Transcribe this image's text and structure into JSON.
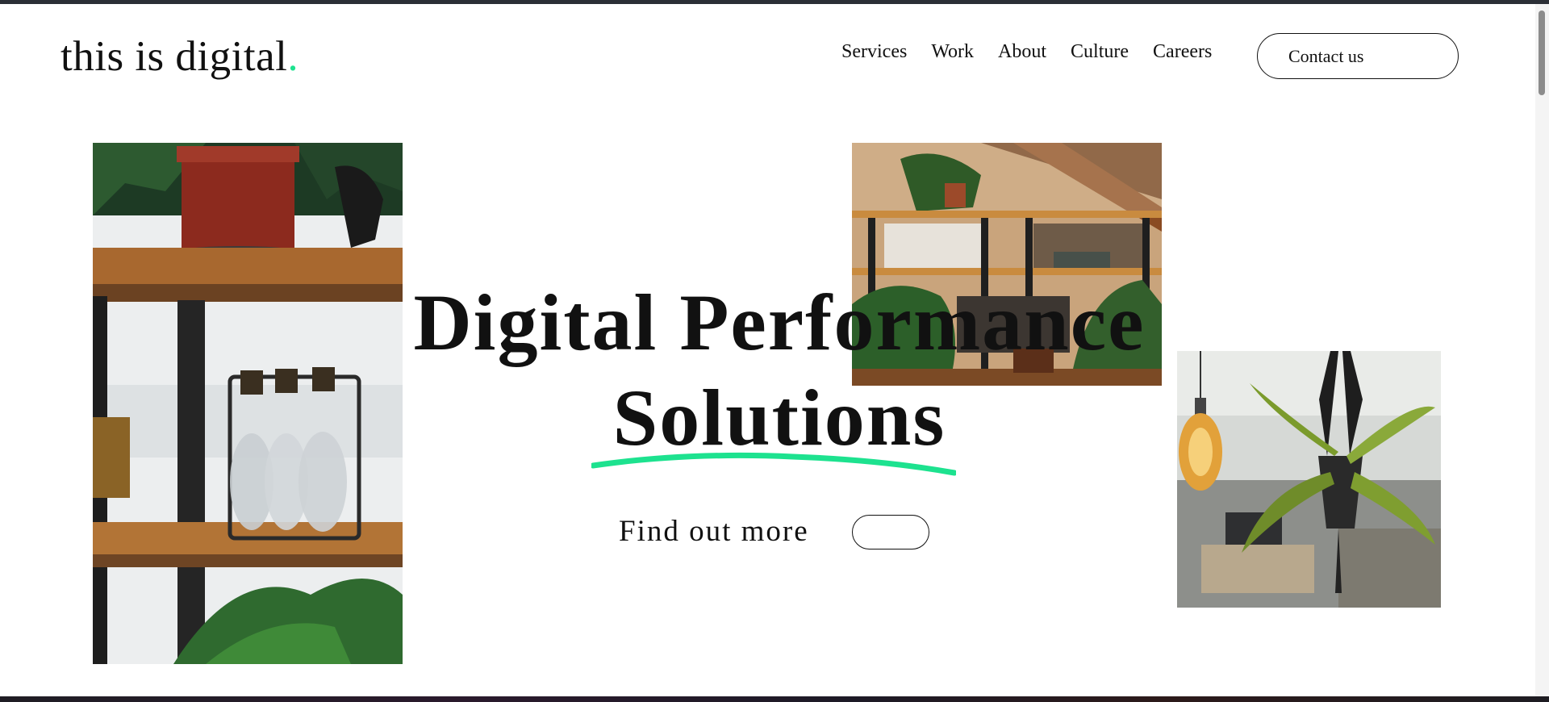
{
  "brand": {
    "name": "this is digital",
    "dot": ".",
    "accent_color": "#1de28f"
  },
  "nav": {
    "items": [
      {
        "label": "Services"
      },
      {
        "label": "Work"
      },
      {
        "label": "About"
      },
      {
        "label": "Culture"
      },
      {
        "label": "Careers"
      }
    ],
    "contact_label": "Contact us"
  },
  "hero": {
    "title_line1": "Digital Performance",
    "title_line2": "Solutions",
    "cta_label": "Find out more",
    "underline_color": "#1de28f"
  },
  "images": {
    "left": "shelf-with-plant-and-bottles-photo",
    "middle": "office-shelves-with-plants-photo",
    "right": "hanging-plant-and-bulb-photo"
  }
}
